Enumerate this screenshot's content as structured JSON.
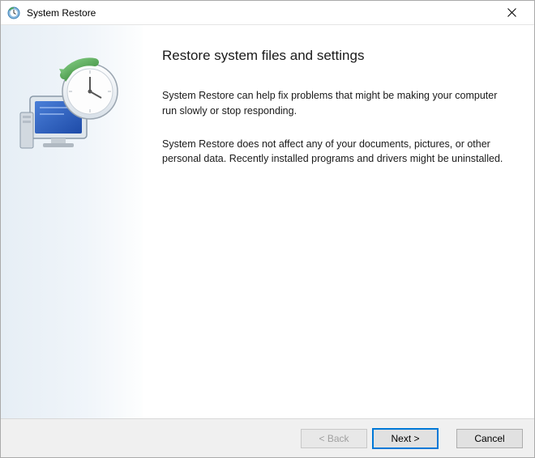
{
  "titlebar": {
    "title": "System Restore"
  },
  "main": {
    "heading": "Restore system files and settings",
    "paragraph1": "System Restore can help fix problems that might be making your computer run slowly or stop responding.",
    "paragraph2": "System Restore does not affect any of your documents, pictures, or other personal data. Recently installed programs and drivers might be uninstalled."
  },
  "footer": {
    "back": "< Back",
    "next": "Next >",
    "cancel": "Cancel"
  }
}
